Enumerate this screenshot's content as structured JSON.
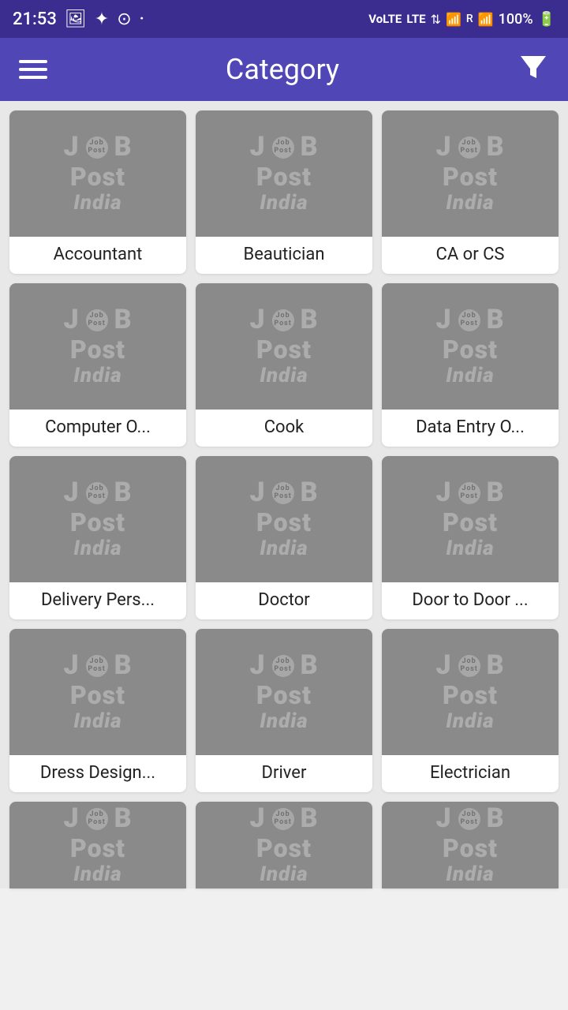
{
  "statusBar": {
    "time": "21:53",
    "battery": "100%"
  },
  "header": {
    "title": "Category",
    "menu_label": "Menu",
    "filter_label": "Filter"
  },
  "categories": [
    {
      "id": 1,
      "label": "Accountant"
    },
    {
      "id": 2,
      "label": "Beautician"
    },
    {
      "id": 3,
      "label": "CA or CS"
    },
    {
      "id": 4,
      "label": "Computer O..."
    },
    {
      "id": 5,
      "label": "Cook"
    },
    {
      "id": 6,
      "label": "Data Entry O..."
    },
    {
      "id": 7,
      "label": "Delivery Pers..."
    },
    {
      "id": 8,
      "label": "Doctor"
    },
    {
      "id": 9,
      "label": "Door to Door ..."
    },
    {
      "id": 10,
      "label": "Dress Design..."
    },
    {
      "id": 11,
      "label": "Driver"
    },
    {
      "id": 12,
      "label": "Electrician"
    }
  ],
  "partialCategories": [
    {
      "id": 13,
      "label": ""
    },
    {
      "id": 14,
      "label": ""
    },
    {
      "id": 15,
      "label": ""
    }
  ],
  "watermark": {
    "j": "J",
    "b": "B",
    "logo": "Job\nPost",
    "post": "Post",
    "india": "India"
  }
}
